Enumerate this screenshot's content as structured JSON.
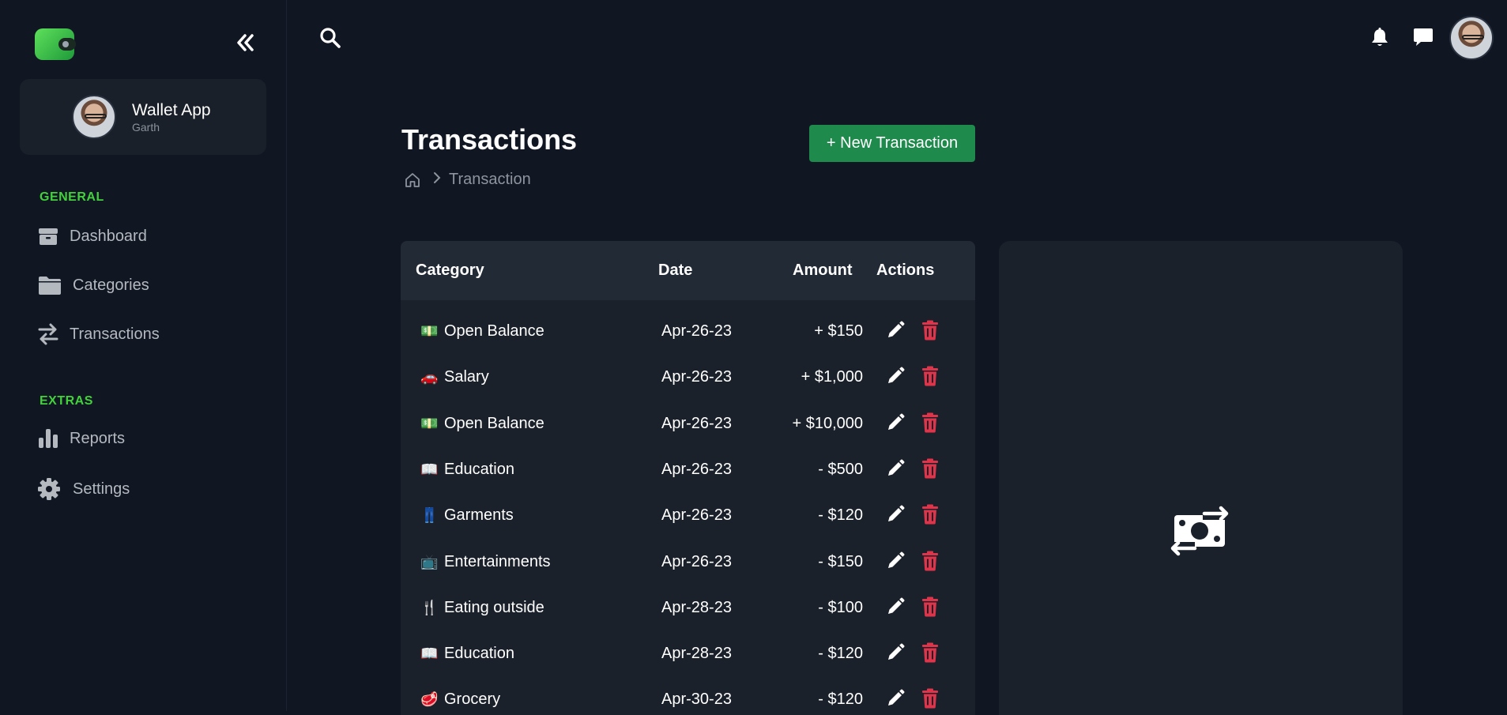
{
  "app": {
    "name": "Wallet App",
    "user": "Garth",
    "colors": {
      "accent": "#42d13c",
      "primary_button": "#1e8a4c",
      "delete": "#e0344b",
      "background": "#111722",
      "card": "#1b212b"
    }
  },
  "sidebar": {
    "collapse_icon": "double-chevron-left-icon",
    "sections": [
      {
        "label": "GENERAL",
        "items": [
          {
            "label": "Dashboard",
            "icon": "box-icon"
          },
          {
            "label": "Categories",
            "icon": "folder-icon"
          },
          {
            "label": "Transactions",
            "icon": "arrows-swap-icon"
          }
        ]
      },
      {
        "label": "EXTRAS",
        "items": [
          {
            "label": "Reports",
            "icon": "bar-chart-icon"
          },
          {
            "label": "Settings",
            "icon": "gear-icon"
          }
        ]
      }
    ]
  },
  "topbar": {
    "icons": [
      "search-icon",
      "bell-icon",
      "chat-icon",
      "avatar"
    ]
  },
  "page": {
    "title": "Transactions",
    "new_button": "+ New Transaction",
    "breadcrumb": {
      "home_icon": "home-icon",
      "current": "Transaction"
    }
  },
  "table": {
    "headers": {
      "category": "Category",
      "date": "Date",
      "amount": "Amount",
      "actions": "Actions"
    },
    "rows": [
      {
        "emoji": "💵",
        "category": "Open Balance",
        "date": "Apr-26-23",
        "amount": "+ $150"
      },
      {
        "emoji": "🚗",
        "category": "Salary",
        "date": "Apr-26-23",
        "amount": "+ $1,000"
      },
      {
        "emoji": "💵",
        "category": "Open Balance",
        "date": "Apr-26-23",
        "amount": "+ $10,000"
      },
      {
        "emoji": "📖",
        "category": "Education",
        "date": "Apr-26-23",
        "amount": "- $500"
      },
      {
        "emoji": "👖",
        "category": "Garments",
        "date": "Apr-26-23",
        "amount": "- $120"
      },
      {
        "emoji": "📺",
        "category": "Entertainments",
        "date": "Apr-26-23",
        "amount": "- $150"
      },
      {
        "emoji": "🍴",
        "category": "Eating outside",
        "date": "Apr-28-23",
        "amount": "- $100"
      },
      {
        "emoji": "📖",
        "category": "Education",
        "date": "Apr-28-23",
        "amount": "- $120"
      },
      {
        "emoji": "🥩",
        "category": "Grocery",
        "date": "Apr-30-23",
        "amount": "- $120"
      }
    ]
  },
  "side_panel": {
    "icon": "money-transfer-icon"
  }
}
